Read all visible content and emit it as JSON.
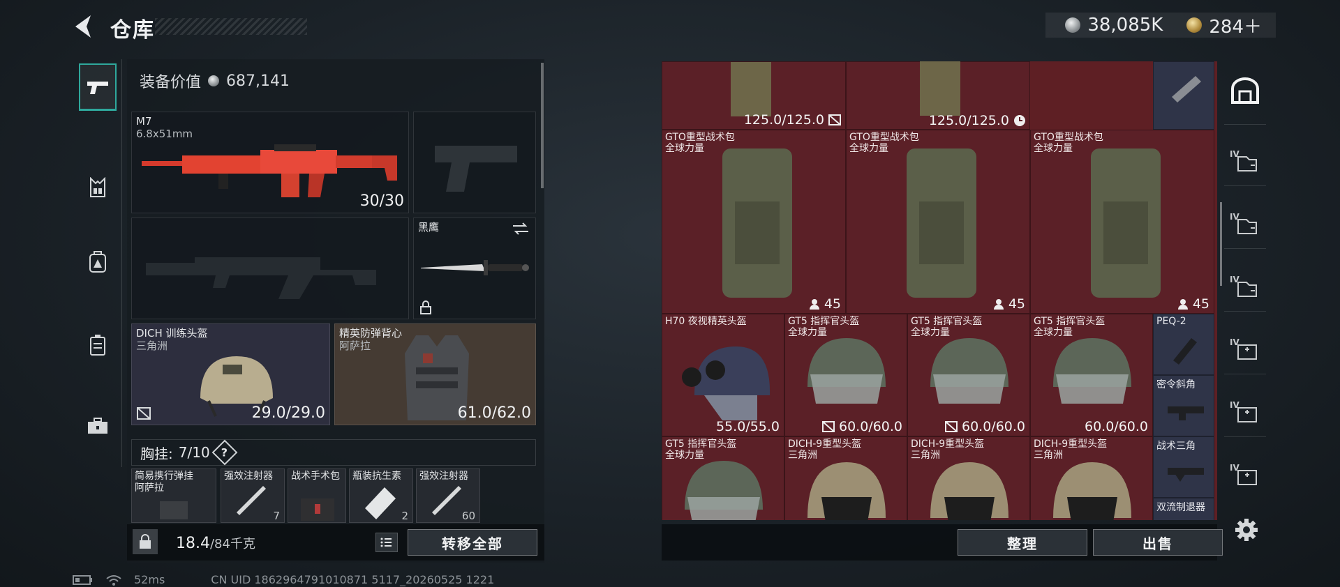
{
  "header": {
    "title": "仓库",
    "currency_silver": "38,085K",
    "currency_gold": "284＋"
  },
  "equipment": {
    "value_label": "装备价值",
    "value": "687,141",
    "primary": {
      "name": "M7",
      "caliber": "6.8x51mm",
      "ammo": "30/30"
    },
    "melee": {
      "name": "黑鹰"
    },
    "helmet": {
      "name": "DICH 训练头盔",
      "origin": "三角洲",
      "durability": "29.0/29.0"
    },
    "vest": {
      "name": "精英防弹背心",
      "origin": "阿萨拉",
      "durability": "61.0/62.0"
    },
    "chest_label": "胸挂:",
    "chest_count": "7/10",
    "chest_help": "?",
    "chest_items": [
      {
        "name": "简易携行弹挂",
        "origin": "阿萨拉"
      },
      {
        "name": "强效注射器",
        "extra": "7"
      },
      {
        "name": "战术手术包"
      },
      {
        "name": "瓶装抗生素",
        "extra": "2"
      },
      {
        "name": "强效注射器",
        "extra": "60"
      }
    ]
  },
  "footer_left": {
    "weight": "18.4",
    "weight_max": "/84千克",
    "transfer_all": "转移全部"
  },
  "storage": {
    "top_row": [
      {
        "value": "125.0/125.0",
        "icon": "no-repair-icon"
      },
      {
        "value": "125.0/125.0",
        "icon": "clock-icon"
      }
    ],
    "backpacks": [
      {
        "name": "GTO重型战术包",
        "origin": "全球力量",
        "count": "45"
      },
      {
        "name": "GTO重型战术包",
        "origin": "全球力量",
        "count": "45"
      },
      {
        "name": "GTO重型战术包",
        "origin": "全球力量",
        "count": "45"
      }
    ],
    "helmets_row1": [
      {
        "name": "H70 夜视精英头盔",
        "origin": "",
        "durability": "55.0/55.0"
      },
      {
        "name": "GT5 指挥官头盔",
        "origin": "全球力量",
        "durability": "60.0/60.0"
      },
      {
        "name": "GT5 指挥官头盔",
        "origin": "全球力量",
        "durability": "60.0/60.0"
      },
      {
        "name": "GT5 指挥官头盔",
        "origin": "全球力量",
        "durability": "60.0/60.0"
      }
    ],
    "helmets_row2": [
      {
        "name": "GT5 指挥官头盔",
        "origin": "全球力量"
      },
      {
        "name": "DICH-9重型头盔",
        "origin": "三角洲"
      },
      {
        "name": "DICH-9重型头盔",
        "origin": "三角洲"
      },
      {
        "name": "DICH-9重型头盔",
        "origin": "三角洲"
      }
    ],
    "side_items": [
      {
        "name": ""
      },
      {
        "name": "PEQ-2"
      },
      {
        "name": "密令斜角"
      },
      {
        "name": "战术三角"
      },
      {
        "name": "双流制退器"
      }
    ]
  },
  "storage_actions": {
    "sort": "整理",
    "sell": "出售"
  },
  "right_tabs": [
    "IV",
    "IV",
    "IV",
    "IV",
    "IV",
    "IV"
  ],
  "status": {
    "ping": "52ms",
    "uid": "CN UID 1862964791010871 5117_20260525 1221"
  },
  "colors": {
    "accent": "#2fa89c",
    "storage_bg": "#5e1f24",
    "helmet_slot": "#2d2e3e",
    "vest_slot": "#453b33"
  }
}
